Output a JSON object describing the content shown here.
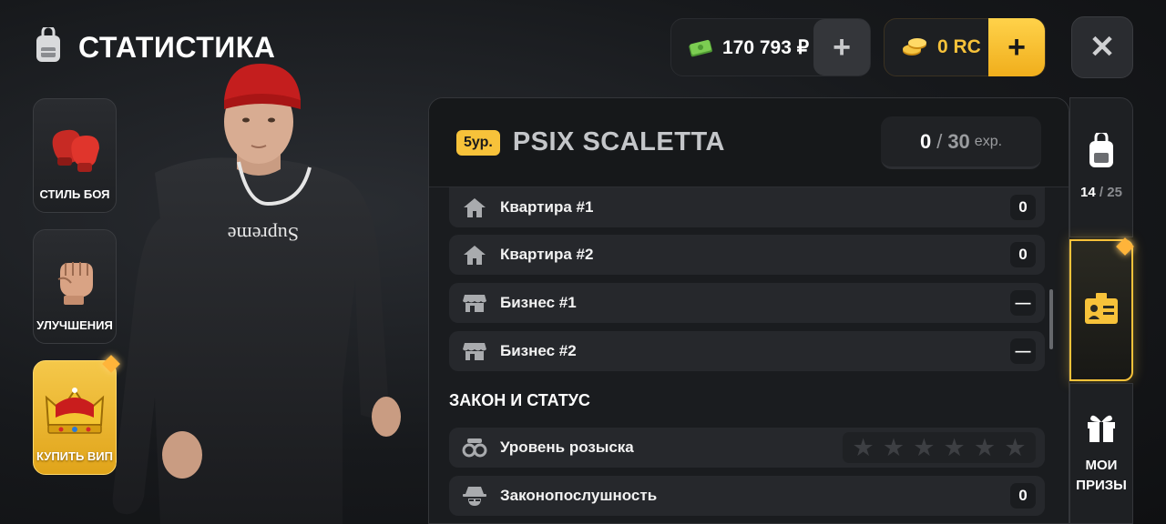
{
  "header": {
    "title": "СТАТИСТИКА",
    "money": "170 793 ₽",
    "money_add": "+",
    "coins": "0 RC",
    "coins_add": "+",
    "close": "✕"
  },
  "left_menu": [
    {
      "label": "СТИЛЬ БОЯ"
    },
    {
      "label": "УЛУЧШЕНИЯ"
    },
    {
      "label": "КУПИТЬ ВИП"
    }
  ],
  "player": {
    "level": "5ур.",
    "name": "PSIX SCALETTA",
    "exp_current": "0",
    "exp_sep": "/",
    "exp_max": "30",
    "exp_unit": "exp."
  },
  "property_rows": [
    {
      "label": "Квартира #1",
      "value": "0",
      "icon": "house-icon"
    },
    {
      "label": "Квартира #2",
      "value": "0",
      "icon": "house-icon"
    },
    {
      "label": "Бизнес #1",
      "value": "—",
      "icon": "shop-icon"
    },
    {
      "label": "Бизнес #2",
      "value": "—",
      "icon": "shop-icon"
    }
  ],
  "law_section": {
    "title": "ЗАКОН И СТАТУС",
    "wanted_label": "Уровень розыска",
    "wanted_stars": 0,
    "wanted_max": 6,
    "obedience_label": "Законопослушность",
    "obedience_value": "0"
  },
  "right_tabs": {
    "inventory_current": "14",
    "inventory_sep": "/",
    "inventory_max": "25",
    "prizes_line1": "МОИ",
    "prizes_line2": "ПРИЗЫ"
  },
  "colors": {
    "accent": "#f7c23a",
    "money_green": "#6fc04a",
    "panel_bg": "#1a1c1f"
  }
}
